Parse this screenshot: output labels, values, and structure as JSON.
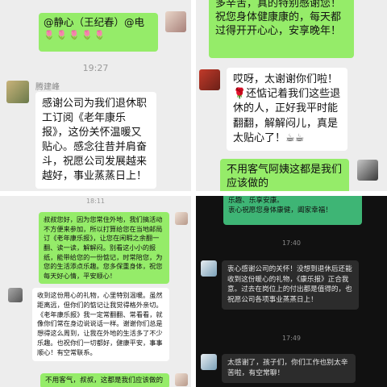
{
  "top_left": {
    "mention_line1": "@静心（王纪春）@电",
    "mention_flowers": "🌷🌷🌷🌷🌷",
    "time": "19:27",
    "sender_name": "腾建峰",
    "message": "感谢公司为我们退休职工订阅《老年康乐报》，这份关怀温暖又贴心。感念往昔并肩奋斗，祝愿公司发展越来越好，事业蒸蒸日上！"
  },
  "top_right": {
    "partial_top": "多辛苦，真的特别感谢您！祝您身体健康康的，每天都过得开开心心，安享晚年！",
    "reply1": "哎呀，太谢谢你们啦！🌹还惦记着我们这些退休的人，正好我平时能翻翻，解解闷儿，真是太贴心了！☕☕",
    "reply2": "不用客气阿姨这都是我们应该做的"
  },
  "bottom_left": {
    "time": "18:11",
    "msg1": "叔叔您好，因为您常住外地，我们搞活动不方便来参加，所以打算给您在当地邮局订《老年康乐报》，让您在闲暇之余翻一翻、读一读，解解闷。别看这小小的报纸，能带给您的一份惦记，时常陪您，为您的生活添点乐趣。您多保重身体，祝您每天好心情，平安顺心！",
    "msg2": "收到这份用心的礼物，心里特别温暖。虽然距离远，但你们的惦记让我觉得格外亲切。《老年康乐报》我一定常翻翻、常看看，就像你们常在身边说说话一样。谢谢你们总是想得这么周到，让我在外地的生活多了不少乐趣。也祝你们一切都好，健康平安，事事顺心！有空常联系。",
    "msg3": "不用客气，叔叔，这都是我们应该做的"
  },
  "bottom_right": {
    "partial_top1": "乐趣、乐享安康。",
    "partial_top2": "衷心祝愿您身体康健，阖家幸福！",
    "time1": "17:40",
    "msg1": "衷心感谢公司的关怀！没想到退休后还能收到这份暖心的礼物，《康乐报》正合我意。过去在岗位上的付出都是值得的，也祝愿公司各项事业蒸蒸日上！",
    "time2": "17:49",
    "msg2": "太感谢了，孩子们，你们工作也别太辛苦啦，有空常聊！"
  },
  "colors": {
    "green_bubble": "#95ec69",
    "dark_green_bubble": "#3eb575",
    "light_bg": "#ededed",
    "dark_bg": "#111111"
  }
}
